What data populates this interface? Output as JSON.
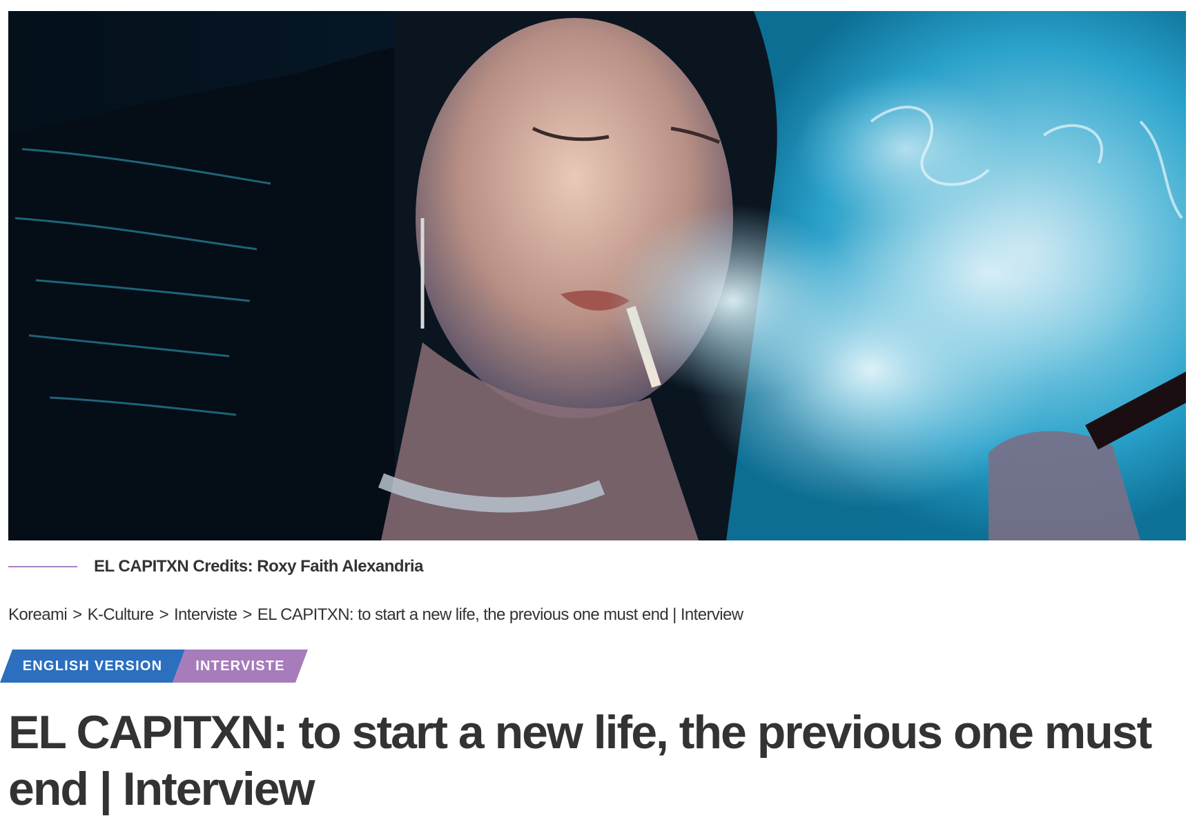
{
  "hero": {
    "image_description": "woman-exhaling-blue-smoke"
  },
  "caption": {
    "text": "EL CAPITXN Credits: Roxy Faith Alexandria",
    "accent_color": "#a97fc4"
  },
  "breadcrumb": {
    "items": [
      "Koreami",
      "K-Culture",
      "Interviste",
      "EL CAPITXN: to start a new life, the previous one must end | Interview"
    ],
    "separator": ">"
  },
  "tags": {
    "english": {
      "label": "ENGLISH VERSION",
      "color": "#2b6fbe"
    },
    "interviste": {
      "label": "INTERVISTE",
      "color": "#a67cbb"
    }
  },
  "article": {
    "title": "EL CAPITXN: to start a new life, the previous one must end | Interview"
  }
}
